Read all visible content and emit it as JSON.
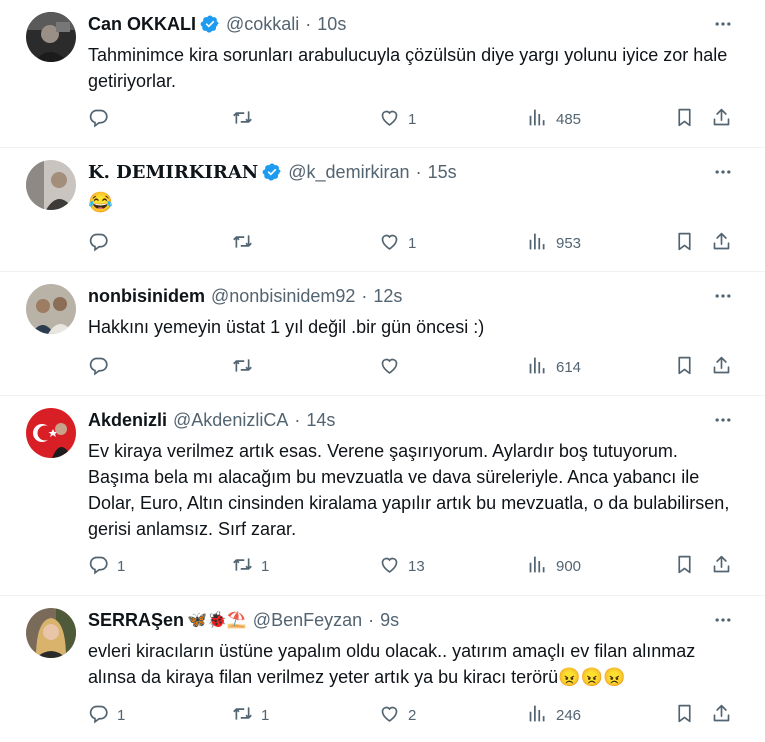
{
  "tweets": [
    {
      "name": "Can OKKALI",
      "verified": true,
      "handle": "@cokkali",
      "time": "10s",
      "text": "Tahminimce kira sorunları arabulucuyla çözülsün diye yargı yolunu iyice zor hale getiriyorlar.",
      "replies": "",
      "retweets": "",
      "likes": "1",
      "views": "485"
    },
    {
      "name": "K. DEMIRKIRAN",
      "verified": true,
      "handle": "@k_demirkiran",
      "time": "15s",
      "text": "😂",
      "replies": "",
      "retweets": "",
      "likes": "1",
      "views": "953"
    },
    {
      "name": "nonbisinidem",
      "verified": false,
      "handle": "@nonbisinidem92",
      "time": "12s",
      "text": "Hakkını yemeyin üstat 1 yıl değil .bir gün öncesi :)",
      "replies": "",
      "retweets": "",
      "likes": "",
      "views": "614"
    },
    {
      "name": "Akdenizli",
      "verified": false,
      "handle": "@AkdenizliCA",
      "time": "14s",
      "text": "Ev kiraya verilmez artık esas. Verene şaşırıyorum. Aylardır boş tutuyorum. Başıma bela mı alacağım bu mevzuatla ve dava süreleriyle. Anca yabancı ile Dolar, Euro, Altın cinsinden kiralama yapılır artık bu mevzuatla, o da bulabilirsen, gerisi anlamsız. Sırf zarar.",
      "replies": "1",
      "retweets": "1",
      "likes": "13",
      "views": "900"
    },
    {
      "name": "SERRAŞen",
      "name_emoji": "🦋🐞⛱️",
      "verified": false,
      "handle": "@BenFeyzan",
      "time": "9s",
      "text": "evleri kiracıların üstüne yapalım oldu olacak.. yatırım amaçlı ev filan alınmaz alınsa da kiraya filan verilmez yeter artık ya bu kiracı terörü😠😠😠",
      "replies": "1",
      "retweets": "1",
      "likes": "2",
      "views": "246"
    }
  ],
  "colors": {
    "text": "#0f1419",
    "muted": "#536471",
    "verified": "#1d9bf0",
    "border": "#eff3f4"
  },
  "icons": [
    "more-icon",
    "reply-icon",
    "retweet-icon",
    "like-icon",
    "views-icon",
    "bookmark-icon",
    "share-icon",
    "verified-badge-icon"
  ]
}
